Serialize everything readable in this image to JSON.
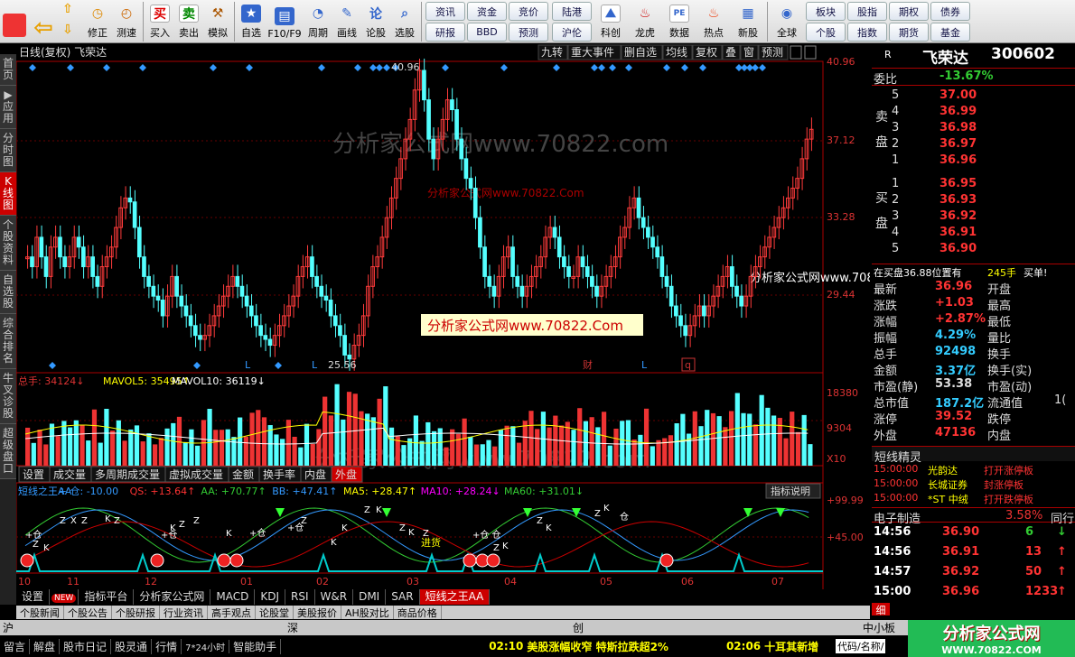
{
  "toolbar": {
    "left": [
      "修正",
      "测速"
    ],
    "actions": [
      "买入",
      "卖出",
      "模拟",
      "自选",
      "F10/F9",
      "周期",
      "画线",
      "论股",
      "选股"
    ],
    "grid1": [
      "资讯",
      "资金",
      "竞价",
      "研报",
      "BBD",
      "预测"
    ],
    "grid2_row": [
      "陆港",
      "沪伦"
    ],
    "mid": [
      "科创",
      "龙虎",
      "数据",
      "热点",
      "新股"
    ],
    "global": "全球",
    "grid3": [
      "板块",
      "股指",
      "期权",
      "债券",
      "个股",
      "指数",
      "期货",
      "基金"
    ]
  },
  "chart": {
    "header": "日线(复权)  飞荣达",
    "header_btns": [
      "九转",
      "重大事件",
      "删自选",
      "均线",
      "复权",
      "叠",
      "窗",
      "预测"
    ],
    "price_ticks": [
      "40.96",
      "37.12",
      "33.28",
      "29.44",
      "25.56"
    ],
    "high_label": "40.96",
    "low_label": "25.56",
    "watermark": "分析家公式网www.70822.com",
    "wm2": "分析家公式网www.70822.Com",
    "wm3": "分析家公式网www.70822.Com",
    "wm4": "分析家公式网www.70822.com",
    "marks": [
      "L",
      "L",
      "财",
      "L",
      "q"
    ],
    "vol_legend": {
      "a": "总手: 34124↓",
      "b": "MAVOL5: 35495↑",
      "c": "MAVOL10: 36119↓"
    },
    "vol_ticks": [
      "18380",
      "9304",
      "X10"
    ],
    "vol_tabs": [
      "设置",
      "成交量",
      "多周期成交量",
      "虚拟成交量",
      "金额",
      "换手率",
      "内盘",
      "外盘"
    ],
    "ind_legend": [
      "短线之王AA",
      "+ 仓: -10.00",
      "QS: +13.64↑",
      "AA: +70.77↑",
      "BB: +47.41↑",
      "MA5: +28.47↑",
      "MA10: +28.24↓",
      "MA60: +31.01↓"
    ],
    "ind_btn": "指标说明",
    "ind_ticks": [
      "+99.99",
      "+45.00"
    ],
    "x_labels": [
      "10",
      "11",
      "12",
      "01",
      "02",
      "03",
      "04",
      "05",
      "06",
      "07"
    ],
    "ind_zk": [
      "+仓",
      "Z",
      "K",
      "Z",
      "X",
      "Z",
      "K",
      "Z",
      "+仓",
      "K",
      "Z",
      "Z",
      "K",
      "+仓",
      "+仓",
      "Z",
      "K",
      "K",
      "Z",
      "K",
      "Z",
      "K",
      "Z",
      "+仓 仓",
      "Z",
      "K",
      "Z",
      "K",
      "Z",
      "K",
      "仓"
    ],
    "ind_buy": "进货",
    "bottom_tabs": [
      "设置",
      "NEW",
      "指标平台",
      "分析家公式网",
      "MACD",
      "KDJ",
      "RSI",
      "W&R",
      "DMI",
      "SAR",
      "短线之王AA"
    ],
    "news_tabs": [
      "个股新闻",
      "个股公告",
      "个股研报",
      "行业资讯",
      "高手观点",
      "论股堂",
      "美股报价",
      "AH股对比",
      "商品价格"
    ]
  },
  "chart_data": [
    {
      "type": "candlestick",
      "title": "日线(复权) 飞荣达",
      "ylim": [
        25.56,
        40.96
      ],
      "high": 40.96,
      "low": 25.56
    },
    {
      "type": "bar",
      "title": "成交量",
      "series": [
        {
          "name": "总手",
          "values": [
            34124
          ]
        },
        {
          "name": "MAVOL5",
          "values": [
            35495
          ]
        },
        {
          "name": "MAVOL10",
          "values": [
            36119
          ]
        }
      ],
      "ylim": [
        0,
        18380
      ]
    },
    {
      "type": "line",
      "title": "短线之王AA",
      "series": [
        {
          "name": "仓",
          "values": [
            -10.0
          ]
        },
        {
          "name": "QS",
          "values": [
            13.64
          ]
        },
        {
          "name": "AA",
          "values": [
            70.77
          ]
        },
        {
          "name": "BB",
          "values": [
            47.41
          ]
        },
        {
          "name": "MA5",
          "values": [
            28.47
          ]
        },
        {
          "name": "MA10",
          "values": [
            28.24
          ]
        },
        {
          "name": "MA60",
          "values": [
            31.01
          ]
        }
      ],
      "ylim": [
        0,
        99.99
      ]
    }
  ],
  "right": {
    "code_flag": "R",
    "name": "飞荣达",
    "code": "300602",
    "weibi_label": "委比",
    "weibi": "-13.67%",
    "sell_label": "卖盘",
    "buy_label": "买盘",
    "asks": [
      [
        "5",
        "37.00"
      ],
      [
        "4",
        "36.99"
      ],
      [
        "3",
        "36.98"
      ],
      [
        "2",
        "36.97"
      ],
      [
        "1",
        "36.96"
      ]
    ],
    "bids": [
      [
        "1",
        "36.95"
      ],
      [
        "2",
        "36.93"
      ],
      [
        "3",
        "36.92"
      ],
      [
        "4",
        "36.91"
      ],
      [
        "5",
        "36.90"
      ]
    ],
    "hand_line": "在买盘36.88位置有",
    "hand_val": "245手",
    "hand_btn": "买单!",
    "quotes": [
      [
        "最新",
        "36.96",
        "开盘",
        ""
      ],
      [
        "涨跌",
        "+1.03",
        "最高",
        ""
      ],
      [
        "涨幅",
        "+2.87%",
        "最低",
        ""
      ],
      [
        "振幅",
        "4.29%",
        "量比",
        ""
      ],
      [
        "总手",
        "92498",
        "换手",
        ""
      ],
      [
        "金额",
        "3.37亿",
        "换手(实)",
        ""
      ],
      [
        "市盈(静)",
        "53.38",
        "市盈(动)",
        ""
      ],
      [
        "总市值",
        "187.2亿",
        "流通值",
        "1("
      ],
      [
        "涨停",
        "39.52",
        "跌停",
        ""
      ],
      [
        "外盘",
        "47136",
        "内盘",
        ""
      ]
    ],
    "elf_title": "短线精灵",
    "elf": [
      [
        "15:00:00",
        "光韵达",
        "打开涨停板"
      ],
      [
        "15:00:00",
        "长城证券",
        "封涨停板"
      ],
      [
        "15:00:00",
        "*ST 中绒",
        "打开跌停板"
      ]
    ],
    "sector": "电子制造",
    "sector_pct": "3.58%",
    "sector_btn": "同行",
    "ticks": [
      [
        "14:56",
        "36.90",
        "6"
      ],
      [
        "14:56",
        "36.91",
        "13"
      ],
      [
        "14:57",
        "36.92",
        "50"
      ],
      [
        "15:00",
        "36.96",
        "1233"
      ]
    ],
    "tab_detail": "细"
  },
  "status": {
    "idx1": "沪",
    "idx2": "深",
    "idx3": "创",
    "idx4": "中小板",
    "items": [
      "留言",
      "解盘",
      "股市日记",
      "股灵通",
      "行情",
      "7*24小时",
      "智能助手"
    ],
    "ticker1_time": "02:10",
    "ticker1": "美股涨幅收窄 特斯拉跌超2%",
    "ticker2_time": "02:06",
    "ticker2": "十耳其新增",
    "code_prompt": "代码/名称/",
    "logo": "分析家公式网",
    "logo_url": "WWW.70822.COM"
  }
}
